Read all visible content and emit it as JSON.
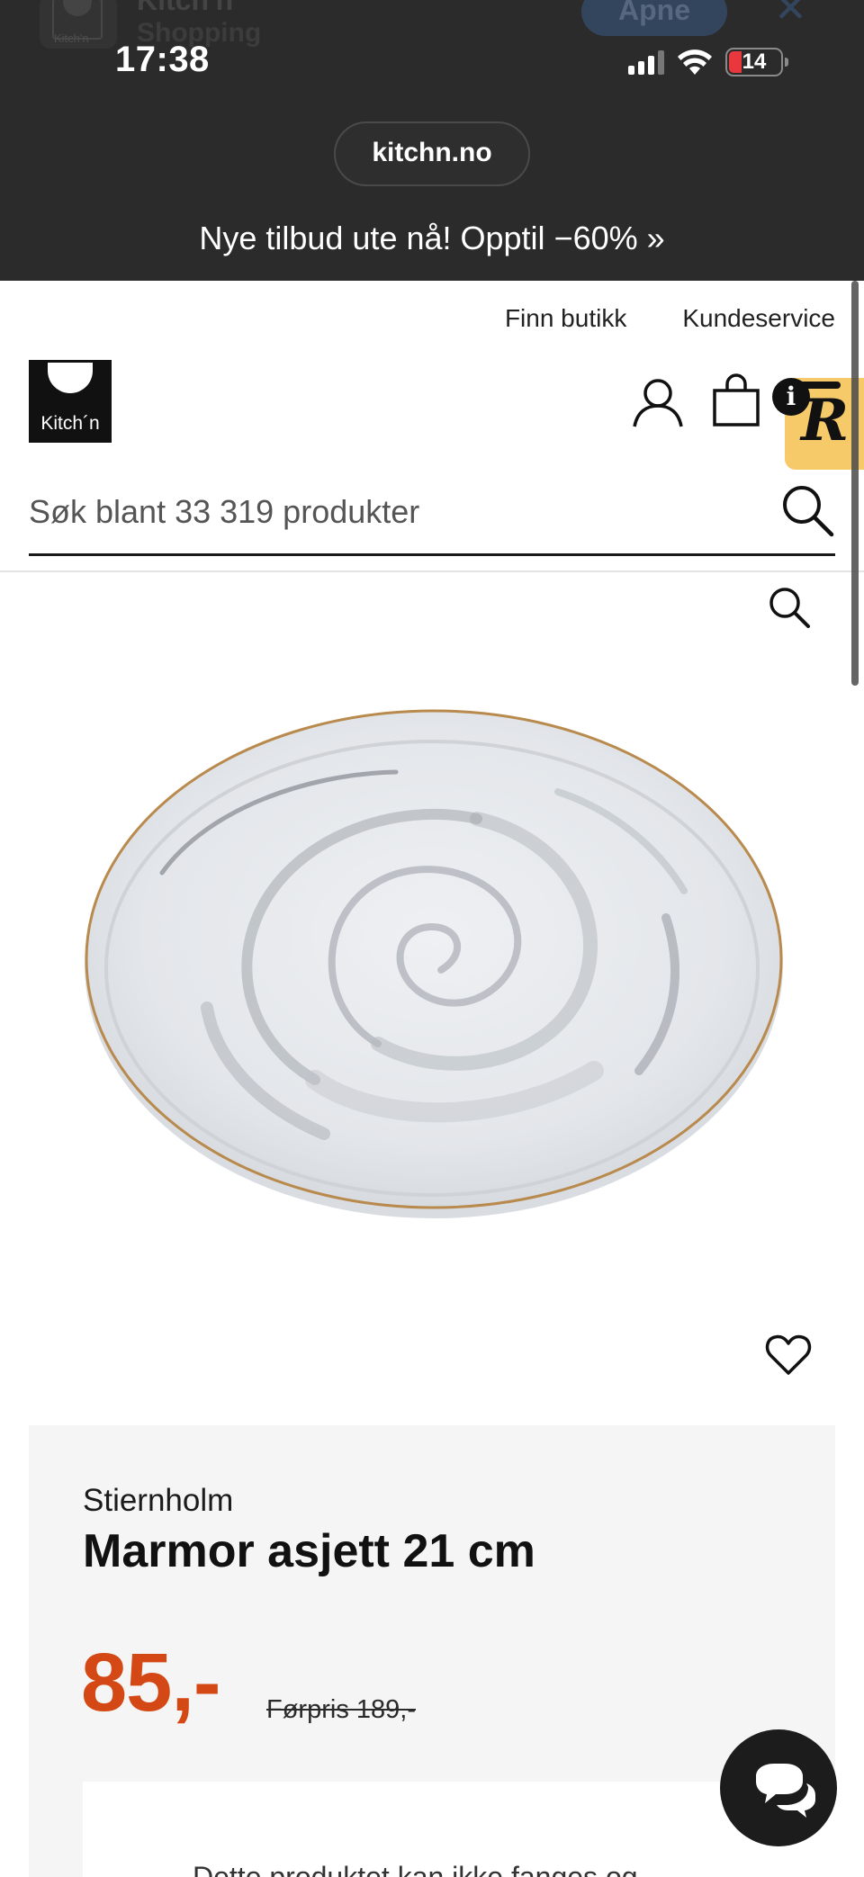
{
  "app_banner": {
    "app_name": "Kitch'n",
    "subtitle": "Shopping",
    "icon_label": "Kitch'n",
    "open_label": "Åpne",
    "close_icon": "close-icon"
  },
  "status_bar": {
    "time": "17:38",
    "battery_level": "14",
    "battery_color": "#e8383d",
    "icons": [
      "cellular-signal-icon",
      "wifi-icon",
      "battery-icon"
    ]
  },
  "browser": {
    "url": "kitchn.no"
  },
  "promo": {
    "text": "Nye tilbud ute nå! Opptil −60% »"
  },
  "header": {
    "utility_links": [
      "Finn butikk",
      "Kundeservice"
    ],
    "logo_text": "Kitch´n",
    "info_badge": "i",
    "rakuten_letter": "R",
    "rakuten_color": "#f6c969",
    "icons": [
      "account-icon",
      "shopping-bag-icon",
      "search-icon"
    ]
  },
  "search": {
    "placeholder": "Søk blant 33 319 produkter",
    "value": ""
  },
  "product": {
    "brand": "Stiernholm",
    "name": "Marmor asjett 21 cm",
    "price": "85,-",
    "price_color": "#d34814",
    "old_price": "Førpris 189,-",
    "notice_partial": "Dette produktet kan ikke fanges og",
    "icons": [
      "zoom-icon",
      "heart-icon",
      "chat-icon"
    ]
  }
}
